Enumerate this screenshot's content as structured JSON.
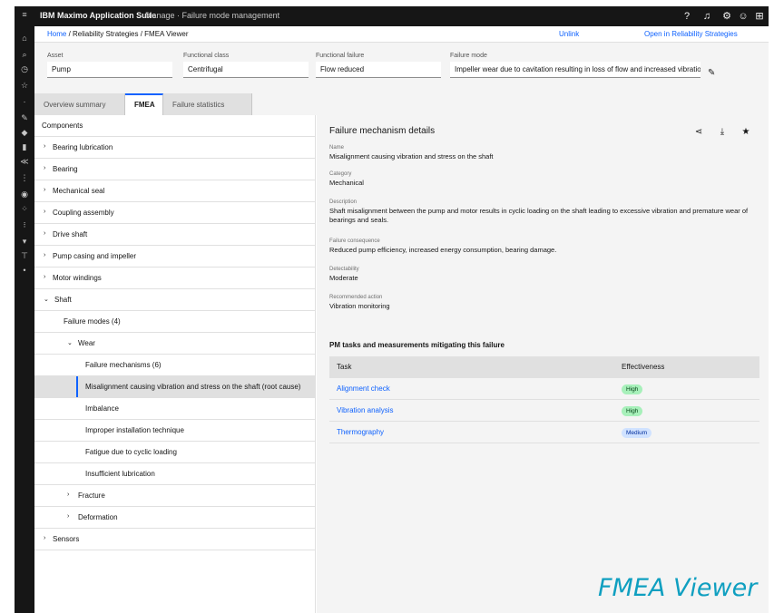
{
  "header": {
    "brand": "IBM Maximo Application Suite",
    "module": "Manage · Failure mode management",
    "icons": [
      "help-icon",
      "notification-icon",
      "settings-icon",
      "user-icon",
      "app-switcher-icon"
    ]
  },
  "rail": {
    "icons": [
      "home-icon",
      "search-icon",
      "recent-icon",
      "favorites-icon",
      "work-icon",
      "assets-icon",
      "inventory-icon",
      "reports-icon",
      "calendar-icon",
      "admin-icon",
      "tools-icon",
      "more-icon"
    ]
  },
  "breadcrumb": {
    "home": "Home",
    "trail": "/ Reliability Strategies / FMEA Viewer",
    "link_left": "Unlink",
    "link_right": "Open in Reliability Strategies"
  },
  "filters": [
    {
      "label": "Asset",
      "value": "Pump"
    },
    {
      "label": "Functional class",
      "value": "Centrifugal"
    },
    {
      "label": "Functional failure",
      "value": "Flow reduced"
    },
    {
      "label": "Failure mode",
      "value": "Impeller wear due to cavitation resulting in loss of flow and increased vibration levels"
    }
  ],
  "filters_more": "✎",
  "tabs": [
    {
      "label": "Overview summary"
    },
    {
      "label": "FMEA"
    },
    {
      "label": "Failure statistics"
    }
  ],
  "tree": {
    "header": "Components",
    "rows": [
      {
        "label": "Bearing lubrication"
      },
      {
        "label": "Bearing"
      },
      {
        "label": "Mechanical seal"
      },
      {
        "label": "Coupling assembly"
      },
      {
        "label": "Drive shaft"
      },
      {
        "label": "Pump casing and impeller"
      },
      {
        "label": "Motor windings"
      },
      {
        "label": "Shaft"
      },
      {
        "label": "Failure modes (4)"
      },
      {
        "label": "Wear"
      },
      {
        "label": "Failure mechanisms (6)"
      },
      {
        "label": "Misalignment causing vibration and stress on the shaft (root cause)"
      },
      {
        "label": "Imbalance"
      },
      {
        "label": "Improper installation technique"
      },
      {
        "label": "Fatigue due to cyclic loading"
      },
      {
        "label": "Insufficient lubrication"
      },
      {
        "label": "Fracture"
      },
      {
        "label": "Deformation"
      },
      {
        "label": "Sensors"
      }
    ]
  },
  "detail": {
    "title": "Failure mechanism details",
    "icons": [
      "share-icon",
      "download-icon",
      "star-icon"
    ],
    "fields": [
      {
        "label": "Name",
        "value": "Misalignment causing vibration and stress on the shaft"
      },
      {
        "label": "Category",
        "value": "Mechanical"
      },
      {
        "label": "Description",
        "value": "Shaft misalignment between the pump and motor results in cyclic loading on the shaft leading to excessive vibration and premature wear of bearings and seals."
      },
      {
        "label": "Failure consequence",
        "value": "Reduced pump efficiency, increased energy consumption, bearing damage."
      },
      {
        "label": "Detectability",
        "value": "Moderate"
      },
      {
        "label": "Recommended action",
        "value": "Vibration monitoring"
      }
    ],
    "table_title": "PM tasks and measurements mitigating this failure",
    "table_headers": [
      "Task",
      "Effectiveness"
    ],
    "table_rows": [
      {
        "task": "Alignment check",
        "effectiveness": "High",
        "level": "high"
      },
      {
        "task": "Vibration analysis",
        "effectiveness": "High",
        "level": "high"
      },
      {
        "task": "Thermography",
        "effectiveness": "Medium",
        "level": "med"
      }
    ]
  },
  "watermark": "FMEA Viewer",
  "colors": {
    "accent": "#0f62fe",
    "header_bg": "#161616",
    "panel_bg": "#f4f4f4",
    "watermark": "#0f9fc0"
  }
}
